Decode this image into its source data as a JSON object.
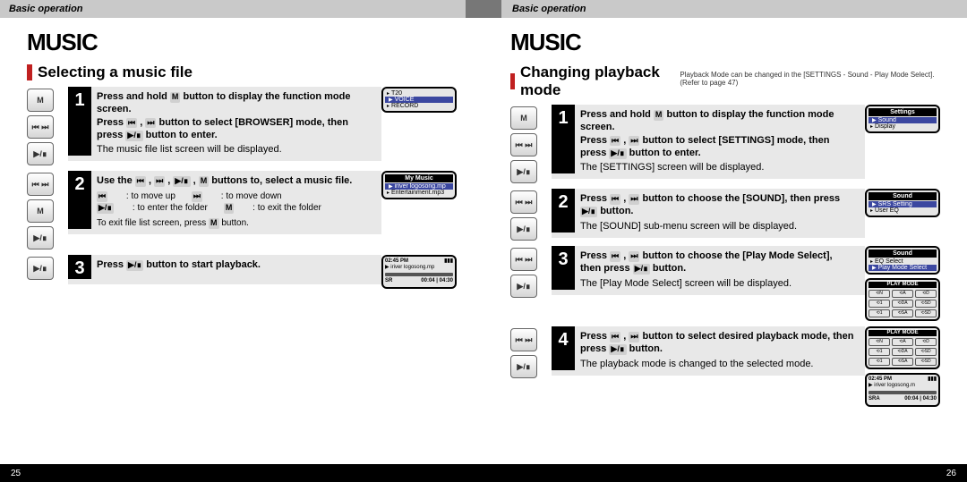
{
  "left": {
    "chapter": "Basic operation",
    "title": "MUSIC",
    "subtitle": "Selecting a music file",
    "pageNum": "25",
    "steps": [
      {
        "buttons": [
          "M",
          "⏮ ⏭",
          "▶/∎"
        ],
        "num": "1",
        "bold1a": "Press and hold ",
        "sym1a": "M",
        "bold1b": " button to display the function mode screen.",
        "bold2a": "Press ",
        "sym2a": "⏮",
        "bold2b": " , ",
        "sym2b": "⏭",
        "bold2c": " button to select [BROWSER] mode, then press ",
        "sym2c": "▶/∎",
        "bold2d": " button to enter.",
        "desc": "The music file list screen will be displayed.",
        "lcd": {
          "items": [
            "T20",
            "VOICE",
            "RECORD"
          ],
          "hl": 1
        }
      },
      {
        "buttons": [
          "⏮ ⏭",
          "M",
          "▶/∎"
        ],
        "num": "2",
        "bold1a": "Use the ",
        "sym1a": "⏮",
        "bold1b": " , ",
        "sym1b": "⏭",
        "bold1c": " , ",
        "sym1c": "▶/∎",
        "bold1d": " , ",
        "sym1d": "M",
        "bold1e": " buttons to, select a music file.",
        "keys": [
          {
            "s": "⏮",
            "t": ": to move up"
          },
          {
            "s": "⏭",
            "t": ": to move down"
          },
          {
            "s": "▶/∎",
            "t": ": to enter the folder"
          },
          {
            "s": "M",
            "t": ": to exit the folder"
          }
        ],
        "tipA": "To exit file list screen, press ",
        "tipSym": "M",
        "tipB": " button.",
        "lcd": {
          "title": "My Music",
          "items": [
            "iriver logosong.mp",
            "Entertainment.mp3"
          ],
          "hl": 0
        }
      },
      {
        "buttons": [
          "▶/∎"
        ],
        "num": "3",
        "bold1a": "Press ",
        "sym1a": "▶/∎",
        "bold1b": " button to start playback.",
        "now": {
          "clock": "02:45 PM",
          "file": "iriver logosong.mp",
          "time": "00:04 | 04:30",
          "mode": "SR"
        }
      }
    ]
  },
  "right": {
    "chapter": "Basic operation",
    "title": "MUSIC",
    "subtitle": "Changing playback mode",
    "note": "Playback Mode can be changed in the [SETTINGS - Sound - Play Mode Select]. (Refer to page 47)",
    "pageNum": "26",
    "steps": [
      {
        "buttons": [
          "M",
          "⏮ ⏭",
          "▶/∎"
        ],
        "num": "1",
        "bold1a": "Press and hold ",
        "sym1a": "M",
        "bold1b": " button to display the function mode screen.",
        "bold2a": "Press ",
        "sym2a": "⏮",
        "bold2b": " , ",
        "sym2b": "⏭",
        "bold2c": " button to select [SETTINGS] mode, then press ",
        "sym2c": "▶/∎",
        "bold2d": " button to enter.",
        "desc": "The [SETTINGS] screen will be displayed.",
        "lcd": {
          "title": "Settings",
          "items": [
            "Sound",
            "Display"
          ],
          "hl": 0
        }
      },
      {
        "buttons": [
          "⏮ ⏭",
          "▶/∎"
        ],
        "num": "2",
        "bold1a": "Press ",
        "sym1a": "⏮",
        "bold1b": " , ",
        "sym1b": "⏭",
        "bold1c": " button to choose the [SOUND], then press ",
        "sym1c": "▶/∎",
        "bold1d": " button.",
        "desc": "The [SOUND] sub-menu screen will be displayed.",
        "lcd": {
          "title": "Sound",
          "items": [
            "SRS Setting",
            "User EQ"
          ],
          "hl": 0
        }
      },
      {
        "buttons": [
          "⏮ ⏭",
          "▶/∎"
        ],
        "num": "3",
        "bold1a": "Press ",
        "sym1a": "⏮",
        "bold1b": " , ",
        "sym1b": "⏭",
        "bold1c": " button to choose the [Play Mode Select], then press ",
        "sym1c": "▶/∎",
        "bold1d": " button.",
        "desc": "The [Play Mode Select] screen will be displayed.",
        "lcd": {
          "title": "Sound",
          "items": [
            "EQ Select",
            "Play Mode Select"
          ],
          "hl": 1
        },
        "playmode": true
      },
      {
        "buttons": [
          "⏮ ⏭",
          "▶/∎"
        ],
        "num": "4",
        "bold1a": "Press ",
        "sym1a": "⏮",
        "bold1b": " , ",
        "sym1b": "⏭",
        "bold1c": " button to select desired playback mode, then press ",
        "sym1c": "▶/∎",
        "bold1d": " button.",
        "desc": "The playback mode is changed to the selected mode.",
        "now": {
          "clock": "02:45 PM",
          "file": "iriver logosong.m",
          "time": "00:04 | 04:30",
          "mode": "SRA"
        },
        "playmode": true
      }
    ],
    "playmodes": [
      "N",
      "A",
      "D",
      "1",
      "DA",
      "SD",
      "1",
      "SA",
      "SD"
    ]
  }
}
